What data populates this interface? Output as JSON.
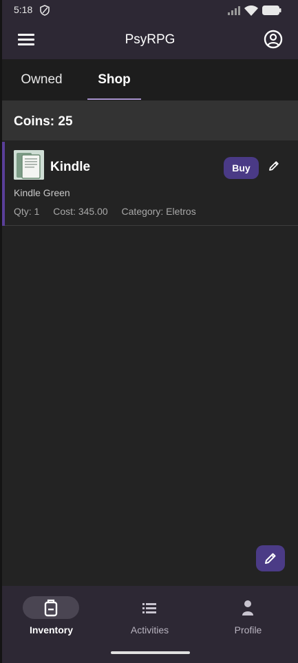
{
  "status_bar": {
    "time": "5:18",
    "icons": [
      "shield-icon",
      "signal-icon",
      "wifi-icon",
      "battery-icon"
    ]
  },
  "app_bar": {
    "title": "PsyRPG",
    "left_icon": "menu-icon",
    "right_icon": "account-circle-icon"
  },
  "tabs": [
    {
      "label": "Owned",
      "selected": false
    },
    {
      "label": "Shop",
      "selected": true
    }
  ],
  "coins": {
    "label": "Coins: 25"
  },
  "items": [
    {
      "name": "Kindle",
      "description": "Kindle Green",
      "qty": "Qty: 1",
      "cost": "Cost: 345.00",
      "category": "Category: Eletros",
      "buy_label": "Buy",
      "thumbnail_icon": "kindle-image"
    }
  ],
  "fab": {
    "icon": "pencil-icon"
  },
  "bottom_nav": [
    {
      "label": "Inventory",
      "icon": "backpack-icon",
      "active": true
    },
    {
      "label": "Activities",
      "icon": "list-icon",
      "active": false
    },
    {
      "label": "Profile",
      "icon": "person-icon",
      "active": false
    }
  ],
  "colors": {
    "app_bar": "#2d2834",
    "background": "#232323",
    "accent": "#4a3a86",
    "tab_indicator": "#a893cf",
    "coins_bar": "#333333"
  }
}
